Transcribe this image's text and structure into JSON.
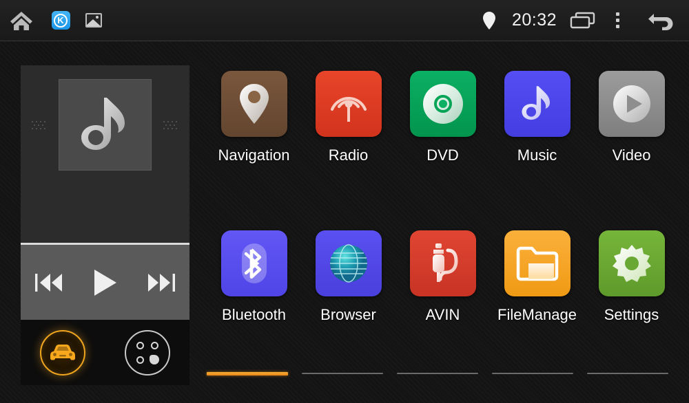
{
  "statusbar": {
    "left_icons": [
      {
        "name": "home-icon",
        "label": "Home"
      },
      {
        "name": "kinemaster-notification-icon",
        "label": "K"
      },
      {
        "name": "photo-notification-icon",
        "label": "Image"
      }
    ],
    "clock": "20:32",
    "right_icons": [
      {
        "name": "location-pin-icon",
        "label": "Location"
      },
      {
        "name": "recents-icon",
        "label": "Recents"
      },
      {
        "name": "overflow-menu-icon",
        "label": "Menu"
      },
      {
        "name": "back-icon",
        "label": "Back"
      }
    ]
  },
  "music_widget": {
    "album_art_icon": "music-note-icon",
    "controls": [
      {
        "name": "previous-button",
        "label": "Previous"
      },
      {
        "name": "play-button",
        "label": "Play"
      },
      {
        "name": "next-button",
        "label": "Next"
      }
    ],
    "bottom_buttons": [
      {
        "name": "car-mode-button",
        "label": "Car"
      },
      {
        "name": "app-drawer-button",
        "label": "Apps"
      }
    ],
    "accent_color": "#f0a51e"
  },
  "apps": {
    "rows": [
      [
        {
          "label": "Navigation",
          "icon": "map-pin-icon",
          "color": "#6f4e37"
        },
        {
          "label": "Radio",
          "icon": "radio-waves-icon",
          "color": "#dd3c22"
        },
        {
          "label": "DVD",
          "icon": "disc-icon",
          "color": "#05a457"
        },
        {
          "label": "Music",
          "icon": "music-note-icon",
          "color": "#4b45e8"
        },
        {
          "label": "Video",
          "icon": "play-circle-icon",
          "color": "#8e8e8e"
        }
      ],
      [
        {
          "label": "Bluetooth",
          "icon": "bluetooth-icon",
          "color": "#5a4ef0"
        },
        {
          "label": "Browser",
          "icon": "globe-icon",
          "color": "#4f46e0"
        },
        {
          "label": "AVIN",
          "icon": "av-input-icon",
          "color": "#d4392a"
        },
        {
          "label": "FileManage",
          "icon": "folder-icon",
          "color": "#f5a623"
        },
        {
          "label": "Settings",
          "icon": "gear-icon",
          "color": "#69a832"
        }
      ]
    ]
  },
  "page_indicator": {
    "count": 5,
    "active_index": 0,
    "active_color": "#ef9320",
    "inactive_color": "#6b6b6b"
  }
}
